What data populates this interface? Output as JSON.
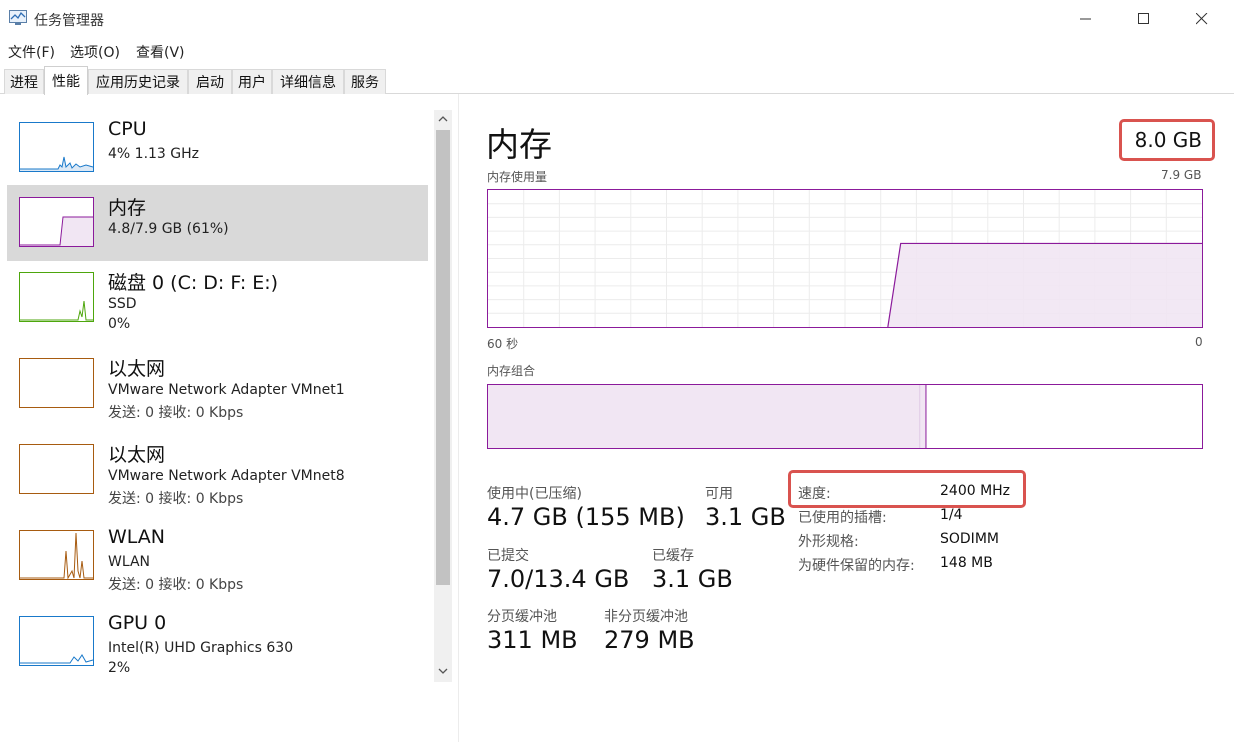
{
  "window": {
    "title": "任务管理器",
    "icon": "task-manager-icon"
  },
  "menu": [
    "文件(F)",
    "选项(O)",
    "查看(V)"
  ],
  "tabs": [
    {
      "label": "进程",
      "active": false
    },
    {
      "label": "性能",
      "active": true
    },
    {
      "label": "应用历史记录",
      "active": false
    },
    {
      "label": "启动",
      "active": false
    },
    {
      "label": "用户",
      "active": false
    },
    {
      "label": "详细信息",
      "active": false
    },
    {
      "label": "服务",
      "active": false
    }
  ],
  "resources": [
    {
      "name": "CPU",
      "line1": "4% 1.13 GHz",
      "line2": "",
      "color": "#1979ca",
      "selected": false
    },
    {
      "name": "内存",
      "line1": "4.8/7.9 GB (61%)",
      "line2": "",
      "color": "#8b1a9b",
      "selected": true
    },
    {
      "name": "磁盘 0 (C: D: F: E:)",
      "line1": "SSD",
      "line2": "0%",
      "color": "#4da60c",
      "selected": false
    },
    {
      "name": "以太网",
      "line1": "VMware Network Adapter VMnet1",
      "line2": "发送: 0 接收: 0 Kbps",
      "color": "#a75b10",
      "selected": false
    },
    {
      "name": "以太网",
      "line1": "VMware Network Adapter VMnet8",
      "line2": "发送: 0 接收: 0 Kbps",
      "color": "#a75b10",
      "selected": false
    },
    {
      "name": "WLAN",
      "line1": "WLAN",
      "line2": "发送: 0 接收: 0 Kbps",
      "color": "#a75b10",
      "selected": false
    },
    {
      "name": "GPU 0",
      "line1": "Intel(R) UHD Graphics 630",
      "line2": "2%",
      "color": "#1979ca",
      "selected": false
    }
  ],
  "memory": {
    "title": "内存",
    "total": "8.0 GB",
    "usage_label": "内存使用量",
    "usage_max": "7.9 GB",
    "time_left": "60 秒",
    "time_right": "0",
    "composition_label": "内存组合",
    "accent": "#8b1a9b",
    "usage_fraction": 0.61,
    "in_use_fraction": 0.605
  },
  "stats": {
    "in_use_label": "使用中(已压缩)",
    "in_use_value": "4.7 GB (155 MB)",
    "available_label": "可用",
    "available_value": "3.1 GB",
    "committed_label": "已提交",
    "committed_value": "7.0/13.4 GB",
    "cached_label": "已缓存",
    "cached_value": "3.1 GB",
    "paged_label": "分页缓冲池",
    "paged_value": "311 MB",
    "nonpaged_label": "非分页缓冲池",
    "nonpaged_value": "279 MB"
  },
  "details": [
    {
      "label": "速度:",
      "value": "2400 MHz"
    },
    {
      "label": "已使用的插槽:",
      "value": "1/4"
    },
    {
      "label": "外形规格:",
      "value": "SODIMM"
    },
    {
      "label": "为硬件保留的内存:",
      "value": "148 MB"
    }
  ],
  "highlight_color": "#d9534f"
}
